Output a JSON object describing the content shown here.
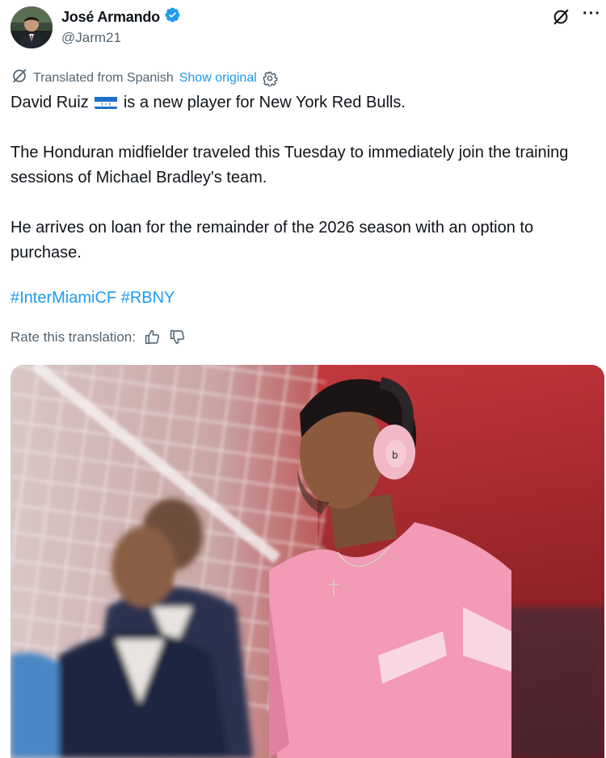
{
  "author": {
    "display_name": "José Armando",
    "handle": "@Jarm21",
    "verified": true
  },
  "actions": {
    "more_label": "···"
  },
  "translation": {
    "notice": "Translated from Spanish",
    "show_original": "Show original",
    "rate_label": "Rate this translation:"
  },
  "tweet": {
    "line1_before_flag": "David Ruiz",
    "line1_after_flag": "is a new player for New York Red Bulls.",
    "paragraph2": "The Honduran midfielder traveled this Tuesday to immediately join the training sessions of Michael Bradley's team.",
    "paragraph3": "He arrives on loan for the remainder of the 2026 season with an option to purchase.",
    "hashtags": [
      "#InterMiamiCF",
      "#RBNY"
    ]
  },
  "colors": {
    "link": "#1d9bf0",
    "secondary_text": "#536471",
    "verified_badge": "#1d9bf0",
    "shirt_pink": "#f29ab6",
    "headphone_pink": "#f2b8c6"
  },
  "icons": {
    "verified": "verified-badge-icon",
    "grok": "grok-icon",
    "translate": "translate-icon",
    "settings": "gear-icon",
    "thumbs_up": "thumbs-up-icon",
    "thumbs_down": "thumbs-down-icon"
  }
}
